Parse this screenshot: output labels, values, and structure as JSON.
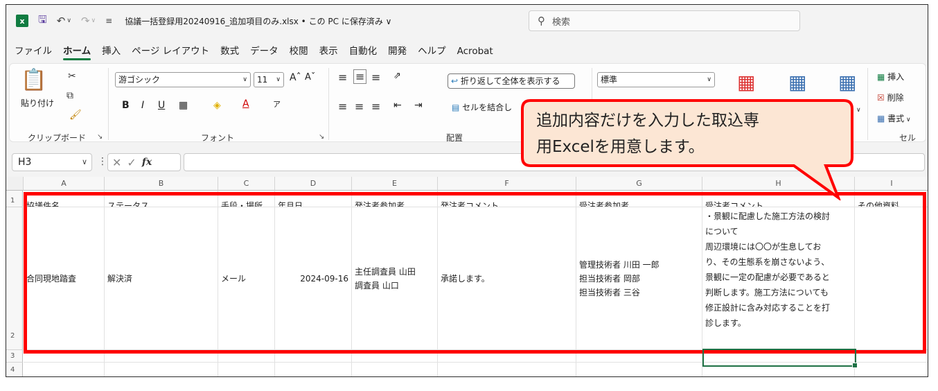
{
  "titlebar": {
    "app_logo": "x",
    "save_icon": "save-icon",
    "undo_icon": "undo-icon",
    "redo_icon": "redo-icon",
    "customize_icon": "customize-icon",
    "doc_title": "協議一括登録用20240916_追加項目のみ.xlsx • この PC に保存済み ∨",
    "search_placeholder": "検索"
  },
  "menu": [
    "ファイル",
    "ホーム",
    "挿入",
    "ページ レイアウト",
    "数式",
    "データ",
    "校閲",
    "表示",
    "自動化",
    "開発",
    "ヘルプ",
    "Acrobat"
  ],
  "ribbon": {
    "clipboard": {
      "paste": "貼り付け",
      "label": "クリップボード"
    },
    "font": {
      "name": "游ゴシック",
      "size": "11",
      "label": "フォント"
    },
    "alignment": {
      "wrap": "折り返して全体を表示する",
      "merge": "セルを結合し",
      "label": "配置"
    },
    "number": {
      "format": "標準"
    },
    "cells": {
      "insert": "挿入",
      "delete": "削除",
      "format": "書式",
      "label": "セル"
    }
  },
  "formula_bar": {
    "name_box": "H3",
    "fx": "fx",
    "formula": ""
  },
  "columns": [
    "A",
    "B",
    "C",
    "D",
    "E",
    "F",
    "G",
    "H",
    "I"
  ],
  "rows": [
    "1",
    "2",
    "3",
    "4"
  ],
  "headers": [
    "協議件名",
    "ステータス",
    "手段・場所",
    "年月日",
    "発注者参加者",
    "発注者コメント",
    "受注者参加者",
    "受注者コメント",
    "その他資料"
  ],
  "record": {
    "subject": "合同現地踏査",
    "status": "解決済",
    "method": "メール",
    "date": "2024-09-16",
    "orderer_participants": [
      "主任調査員 山田",
      "調査員 山口"
    ],
    "orderer_comment": "承諾します。",
    "contractor_participants": [
      "管理技術者 川田 一郎",
      "担当技術者 岡部",
      "担当技術者 三谷"
    ],
    "contractor_comment": [
      "・景観に配慮した施工方法の検討",
      "について",
      "周辺環境には〇〇が生息してお",
      "り、その生態系を崩さないよう、",
      "景観に一定の配慮が必要であると",
      "判断します。施工方法についても",
      "修正設計に含み対応することを打",
      "診します。"
    ]
  },
  "callout": {
    "line1": "追加内容だけを入力した取込専",
    "line2": "用Excelを用意します。"
  },
  "colors": {
    "excel_green": "#107c41",
    "highlight_red": "#ff0000",
    "callout_fill": "#fce6d4"
  }
}
